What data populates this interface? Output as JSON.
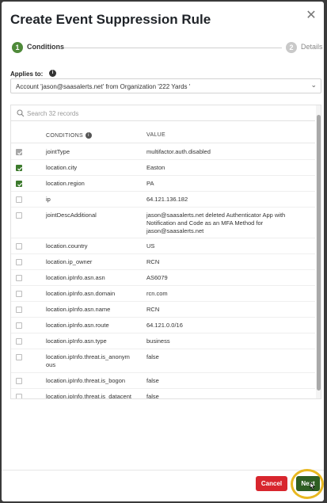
{
  "modal": {
    "title": "Create Event Suppression Rule",
    "close_icon": "close-icon"
  },
  "stepper": {
    "steps": [
      {
        "number": "1",
        "label": "Conditions",
        "state": "active"
      },
      {
        "number": "2",
        "label": "Details",
        "state": "inactive"
      }
    ]
  },
  "applies_to": {
    "label": "Applies to:",
    "info_icon": "info-icon",
    "value": "Account 'jason@saasalerts.net' from Organization '222 Yards '"
  },
  "table": {
    "search_placeholder": "Search 32 records",
    "columns": {
      "conditions": "CONDITIONS",
      "value": "VALUE"
    },
    "rows": [
      {
        "condition": "jointType",
        "value": "multifactor.auth.disabled",
        "checked": true,
        "locked": true
      },
      {
        "condition": "location.city",
        "value": "Easton",
        "checked": true
      },
      {
        "condition": "location.region",
        "value": "PA",
        "checked": true
      },
      {
        "condition": "ip",
        "value": "64.121.136.182",
        "checked": false
      },
      {
        "condition": "jointDescAdditional",
        "value": "jason@saasalerts.net deleted Authenticator App with Notification and Code as an MFA Method for jason@saasalerts.net",
        "checked": false
      },
      {
        "condition": "location.country",
        "value": "US",
        "checked": false
      },
      {
        "condition": "location.ip_owner",
        "value": "RCN",
        "checked": false
      },
      {
        "condition": "location.ipInfo.asn.asn",
        "value": "AS6079",
        "checked": false
      },
      {
        "condition": "location.ipInfo.asn.domain",
        "value": "rcn.com",
        "checked": false
      },
      {
        "condition": "location.ipInfo.asn.name",
        "value": "RCN",
        "checked": false
      },
      {
        "condition": "location.ipInfo.asn.route",
        "value": "64.121.0.0/16",
        "checked": false
      },
      {
        "condition": "location.ipInfo.asn.type",
        "value": "business",
        "checked": false
      },
      {
        "condition": "location.ipInfo.threat.is_anonymous",
        "value": "false",
        "checked": false
      },
      {
        "condition": "location.ipInfo.threat.is_bogon",
        "value": "false",
        "checked": false
      },
      {
        "condition": "location.ipInfo.threat.is_datacenter",
        "value": "false",
        "checked": false
      }
    ]
  },
  "footer": {
    "cancel_label": "Cancel",
    "next_label": "Next"
  },
  "colors": {
    "accent_green": "#3c7a2c",
    "next_button": "#2e5e22",
    "cancel_button": "#d8262e",
    "highlight_ring": "#e8b820"
  }
}
